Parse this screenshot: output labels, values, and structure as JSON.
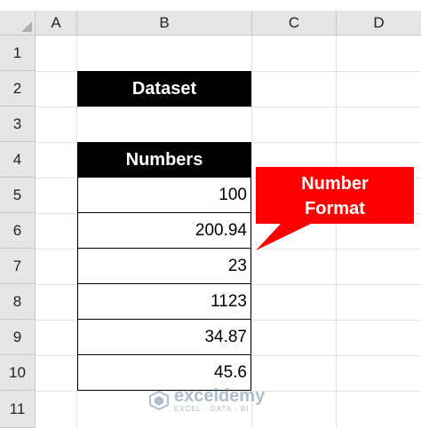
{
  "columns": [
    "A",
    "B",
    "C",
    "D"
  ],
  "rows": [
    "1",
    "2",
    "3",
    "4",
    "5",
    "6",
    "7",
    "8",
    "9",
    "10",
    "11"
  ],
  "title": "Dataset",
  "table": {
    "header": "Numbers",
    "values": [
      "100",
      "200.94",
      "23",
      "1123",
      "34.87",
      "45.6"
    ]
  },
  "callout": {
    "line1": "Number",
    "line2": "Format",
    "color": "#ff0000"
  },
  "watermark": {
    "name": "exceldemy",
    "tagline": "EXCEL · DATA · BI"
  },
  "colors": {
    "header_bg": "#e6e6e6",
    "title_bg": "#000000",
    "title_text": "#ffffff"
  }
}
